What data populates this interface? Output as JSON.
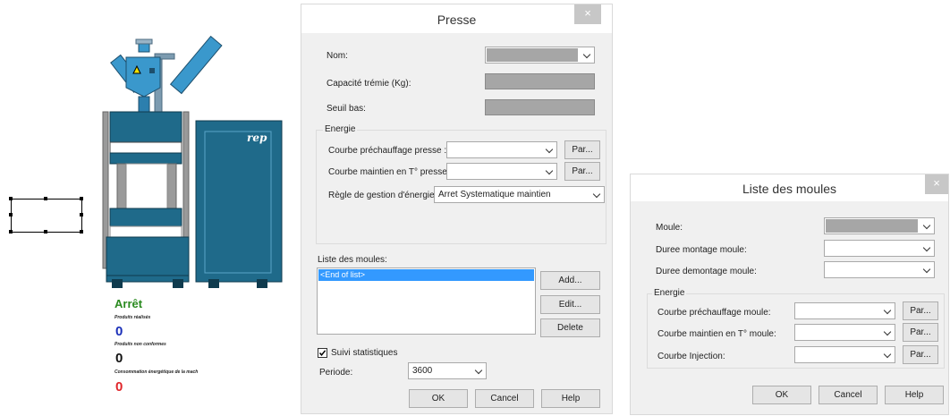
{
  "machine": {
    "brand": "rep",
    "status": "Arrêt",
    "stats": [
      {
        "label": "Produits réalisés",
        "value": "0",
        "color": "#1a2fb8"
      },
      {
        "label": "Produits non conformes",
        "value": "0",
        "color": "#111111"
      },
      {
        "label": "Consommation énergétique de la mach",
        "value": "0",
        "color": "#e0252a"
      }
    ]
  },
  "presse": {
    "title": "Presse",
    "close": "×",
    "nom_label": "Nom:",
    "capacite_label": "Capacité trémie (Kg):",
    "seuil_label": "Seuil bas:",
    "energie_title": "Energie",
    "courbe_prechauffage_label": "Courbe préchauffage presse :",
    "courbe_maintien_label": "Courbe maintien en T° presse :",
    "par_label": "Par...",
    "regle_label": "Règle de gestion d'énergie:",
    "regle_value": "Arret Systematique maintien",
    "liste_label": "Liste des moules:",
    "list_items": [
      "<End of list>"
    ],
    "add_label": "Add...",
    "edit_label": "Edit...",
    "delete_label": "Delete",
    "suivi_label": "Suivi statistiques",
    "suivi_checked": true,
    "periode_label": "Periode:",
    "periode_value": "3600",
    "ok_label": "OK",
    "cancel_label": "Cancel",
    "help_label": "Help"
  },
  "moules": {
    "title": "Liste des moules",
    "close": "×",
    "moule_label": "Moule:",
    "montage_label": "Duree montage moule:",
    "demontage_label": "Duree demontage moule:",
    "energie_title": "Energie",
    "prechauffage_label": "Courbe préchauffage moule:",
    "maintien_label": "Courbe maintien en T° moule:",
    "injection_label": "Courbe Injection:",
    "par_label": "Par...",
    "ok_label": "OK",
    "cancel_label": "Cancel",
    "help_label": "Help"
  },
  "colors": {
    "machine_teal": "#1f6a8a",
    "machine_frame": "#9a9a9a",
    "hopper_blue": "#3a98cc",
    "list_selection": "#3399ff"
  }
}
